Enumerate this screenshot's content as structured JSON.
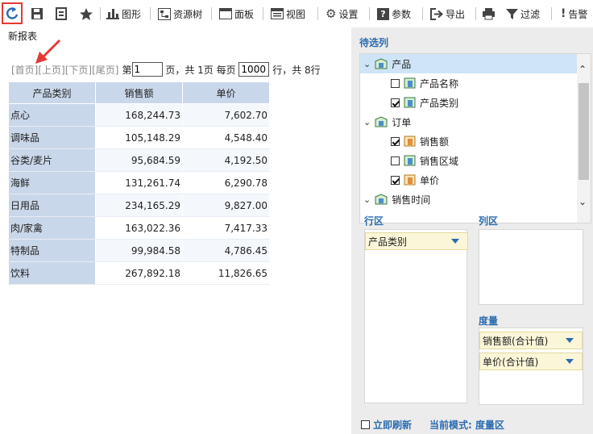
{
  "toolbar": {
    "graph_label": "图形",
    "resource_tree_label": "资源树",
    "panel_label": "面板",
    "view_label": "视图",
    "settings_label": "设置",
    "params_label": "参数",
    "export_label": "导出",
    "filter_label": "过滤",
    "alert_label": "告警"
  },
  "report_title": "新报表",
  "pager": {
    "first": "[首页]",
    "prev": "[上页]",
    "next": "[下页]",
    "last": "[尾页]",
    "page_prefix": "第",
    "page_value": "1",
    "page_mid": " 页，共 1页 每页 ",
    "per_page_value": "1000",
    "page_suffix": " 行，共 8行"
  },
  "table": {
    "headers": [
      "产品类别",
      "销售额",
      "单价"
    ],
    "rows": [
      [
        "点心",
        "168,244.73",
        "7,602.70"
      ],
      [
        "调味品",
        "105,148.29",
        "4,548.40"
      ],
      [
        "谷类/麦片",
        "95,684.59",
        "4,192.50"
      ],
      [
        "海鲜",
        "131,261.74",
        "6,290.78"
      ],
      [
        "日用品",
        "234,165.29",
        "9,827.00"
      ],
      [
        "肉/家禽",
        "163,022.36",
        "7,417.33"
      ],
      [
        "特制品",
        "99,984.58",
        "4,786.45"
      ],
      [
        "饮料",
        "267,892.18",
        "11,826.65"
      ]
    ]
  },
  "panel": {
    "candidates_title": "待选列",
    "tree": [
      {
        "label": "产品",
        "level": 0,
        "expanded": true,
        "selected": true
      },
      {
        "label": "产品名称",
        "level": 1,
        "checked": false
      },
      {
        "label": "产品类别",
        "level": 1,
        "checked": true
      },
      {
        "label": "订单",
        "level": 0,
        "expanded": true
      },
      {
        "label": "销售额",
        "level": 1,
        "checked": true
      },
      {
        "label": "销售区域",
        "level": 1,
        "checked": false
      },
      {
        "label": "单价",
        "level": 1,
        "checked": true
      },
      {
        "label": "销售时间",
        "level": 0,
        "expanded": true
      }
    ],
    "row_area_title": "行区",
    "row_fields": [
      "产品类别"
    ],
    "col_area_title": "列区",
    "measure_title": "度量",
    "measures": [
      "销售额(合计值)",
      "单价(合计值)"
    ],
    "auto_refresh_label": "立即刷新",
    "current_mode_label": "当前模式: 度量区"
  },
  "colors": {
    "accent": "#2b6cb0",
    "highlight_border": "#e53935",
    "header_bg": "#c9d7ea",
    "pill_bg": "#fbf6d8"
  }
}
